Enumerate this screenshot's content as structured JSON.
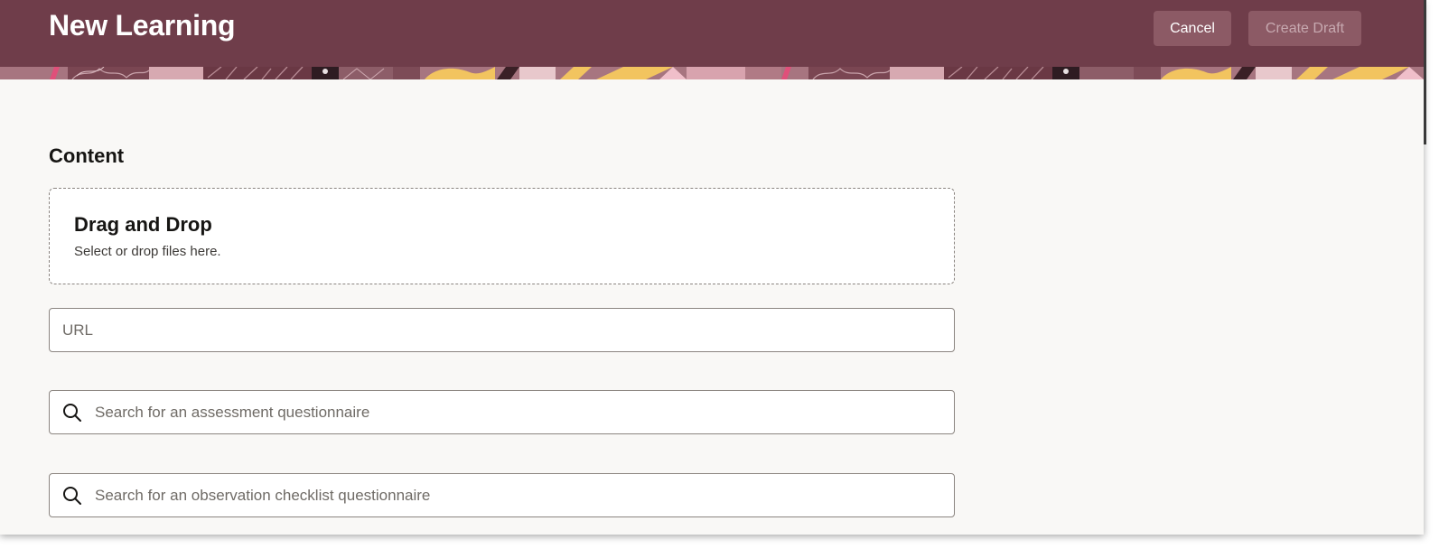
{
  "header": {
    "title": "New Learning",
    "cancel_label": "Cancel",
    "create_draft_label": "Create Draft",
    "background_color": "#6f3d4a"
  },
  "content": {
    "section_title": "Content",
    "dropzone": {
      "title": "Drag and Drop",
      "subtitle": "Select or drop files here."
    },
    "url_field": {
      "placeholder": "URL",
      "value": ""
    },
    "assessment_search": {
      "icon": "search-icon",
      "placeholder": "Search for an assessment questionnaire",
      "value": ""
    },
    "observation_search": {
      "icon": "search-icon",
      "placeholder": "Search for an observation checklist questionnaire",
      "value": ""
    }
  }
}
